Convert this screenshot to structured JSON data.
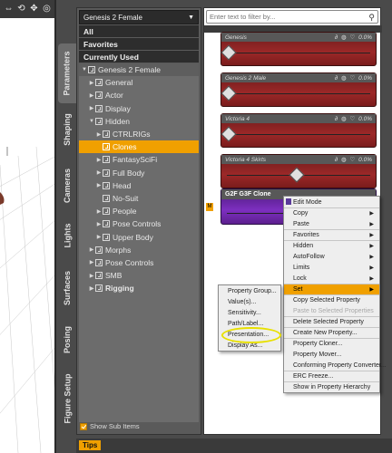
{
  "viewport": {
    "tools": [
      "arrows-icon",
      "rotate-icon",
      "move-icon",
      "orbit-icon"
    ]
  },
  "vertical_tabs": [
    {
      "label": "Parameters",
      "active": true
    },
    {
      "label": "Shaping",
      "active": false
    },
    {
      "label": "Cameras",
      "active": false
    },
    {
      "label": "Lights",
      "active": false
    },
    {
      "label": "Surfaces",
      "active": false
    },
    {
      "label": "Posing",
      "active": false
    },
    {
      "label": "Figure Setup",
      "active": false
    }
  ],
  "tree_panel": {
    "preset": "Genesis 2 Female",
    "quick_items": [
      "All",
      "Favorites",
      "Currently Used"
    ],
    "nodes": [
      {
        "label": "Genesis 2 Female",
        "level": 0,
        "twisty": "▼",
        "parent": true
      },
      {
        "label": "General",
        "level": 1,
        "twisty": "▶"
      },
      {
        "label": "Actor",
        "level": 1,
        "twisty": "▶"
      },
      {
        "label": "Display",
        "level": 1,
        "twisty": "▶"
      },
      {
        "label": "Hidden",
        "level": 1,
        "twisty": "▼"
      },
      {
        "label": "CTRLRIGs",
        "level": 2,
        "twisty": "▶"
      },
      {
        "label": "Clones",
        "level": 2,
        "twisty": "",
        "selected": true
      },
      {
        "label": "FantasySciFi",
        "level": 2,
        "twisty": "▶"
      },
      {
        "label": "Full Body",
        "level": 2,
        "twisty": "▶"
      },
      {
        "label": "Head",
        "level": 2,
        "twisty": "▶"
      },
      {
        "label": "No-Suit",
        "level": 2,
        "twisty": ""
      },
      {
        "label": "People",
        "level": 2,
        "twisty": "▶"
      },
      {
        "label": "Pose Controls",
        "level": 2,
        "twisty": "▶"
      },
      {
        "label": "Upper Body",
        "level": 2,
        "twisty": "▶"
      },
      {
        "label": "Morphs",
        "level": 1,
        "twisty": "▶"
      },
      {
        "label": "Pose Controls",
        "level": 1,
        "twisty": "▶"
      },
      {
        "label": "SMB",
        "level": 1,
        "twisty": "▶"
      },
      {
        "label": "Rigging",
        "level": 1,
        "twisty": "▶",
        "bold": true
      }
    ],
    "show_sub_items": "Show Sub Items"
  },
  "search": {
    "placeholder": "Enter text to filter by..."
  },
  "sliders": [
    {
      "name": "Genesis",
      "value": "0.0%",
      "knob": 0.0
    },
    {
      "name": "Genesis 2 Male",
      "value": "0.0%",
      "knob": 0.0
    },
    {
      "name": "Victoria 4",
      "value": "0.0%",
      "knob": 0.0
    },
    {
      "name": "Victoria 4 Skirts",
      "value": "0.0%",
      "knob": 0.5
    }
  ],
  "clone": {
    "name": "G2F G3F Clone"
  },
  "context_menu": [
    {
      "label": "Edit Mode",
      "checked": true
    },
    {
      "label": "Copy",
      "submenu": true,
      "sep": true
    },
    {
      "label": "Paste",
      "submenu": true
    },
    {
      "label": "Favorites",
      "submenu": true,
      "sep": true
    },
    {
      "label": "Hidden",
      "submenu": true,
      "sep": true
    },
    {
      "label": "AutoFollow",
      "submenu": true
    },
    {
      "label": "Limits",
      "submenu": true
    },
    {
      "label": "Lock",
      "submenu": true
    },
    {
      "label": "Set",
      "submenu": true,
      "highlight": true,
      "sep": true
    },
    {
      "label": "Copy Selected Property",
      "sep": true
    },
    {
      "label": "Paste to Selected Properties",
      "disabled": true
    },
    {
      "label": "Delete Selected Property",
      "sep": true
    },
    {
      "label": "Create New Property...",
      "sep": true
    },
    {
      "label": "Property Cloner...",
      "sep": true
    },
    {
      "label": "Property Mover..."
    },
    {
      "label": "Conforming Property Converter..."
    },
    {
      "label": "ERC Freeze...",
      "sep": true
    },
    {
      "label": "Show in Property Hierarchy",
      "sep": true
    }
  ],
  "set_submenu": [
    {
      "label": "Property Group..."
    },
    {
      "label": "Value(s)..."
    },
    {
      "label": "Sensitivity..."
    },
    {
      "label": "Path/Label..."
    },
    {
      "label": "Presentation...",
      "circled": true
    },
    {
      "label": "Display As..."
    }
  ],
  "tips": "Tips",
  "colors": {
    "accent": "#f0a000",
    "slider_red": "#9c2828",
    "clone_purple": "#7d2fc0",
    "menu_bg": "#eeeeee"
  }
}
